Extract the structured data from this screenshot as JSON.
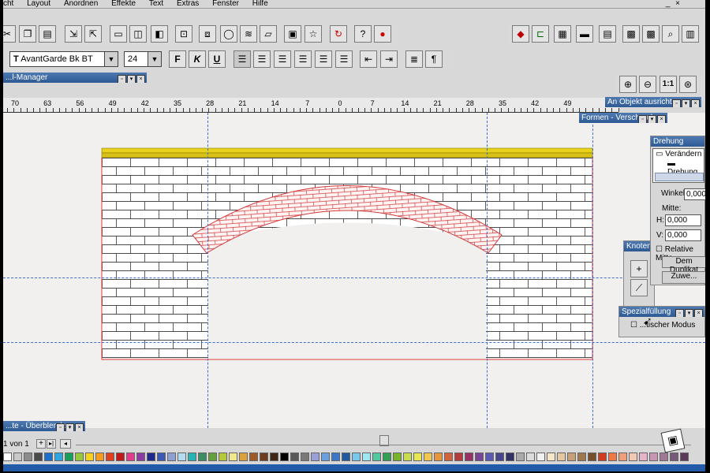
{
  "menu": {
    "items": [
      "cht",
      "Layout",
      "Anordnen",
      "Effekte",
      "Text",
      "Extras",
      "Fenster",
      "Hilfe"
    ]
  },
  "format_toolbar": {
    "font_name": "AvantGarde Bk BT",
    "font_size": "24",
    "bold_label": "F",
    "italic_label": "K",
    "underline_label": "U",
    "para_label": "¶"
  },
  "panels": {
    "manager_title": "...l-Manager",
    "align_title": "An Objekt ausrichten",
    "shapes_title": "Formen - Verschmel...",
    "rotation": {
      "title": "Drehung",
      "tree_root": "Verändern",
      "tree_child": "Drehung",
      "angle_label": "Winkel:",
      "angle_value": "0,000",
      "center_label": "Mitte:",
      "h_label": "H:",
      "h_value": "0,000",
      "v_label": "V:",
      "v_value": "0,000",
      "relative_label": "Relative Mitte",
      "duplicate_button": "Dem Duplikat",
      "apply_button": "Zuwe..."
    },
    "nodes_title": "Knoten...",
    "special_title": "Spezialfüllung",
    "special_mode": "...tischer Modus",
    "blend_title": "...te - Überblender"
  },
  "zoom": {
    "one_to_one": "1:1"
  },
  "ruler": {
    "labels": [
      "70",
      "63",
      "56",
      "49",
      "42",
      "35",
      "28",
      "21",
      "14",
      "7",
      "0",
      "7",
      "14",
      "21",
      "28",
      "35",
      "42",
      "49"
    ]
  },
  "page_nav": {
    "text": "1 von 1"
  },
  "palette": {
    "colors": [
      "#ffffff",
      "#c8c8c8",
      "#8c8c8c",
      "#4a4a4a",
      "#1d70c9",
      "#2ea7e0",
      "#17a05a",
      "#96c83c",
      "#f5d21e",
      "#f39c1e",
      "#e0401e",
      "#c21a1a",
      "#e23c8c",
      "#8c3ca0",
      "#1e2a8c",
      "#3c5ab4",
      "#8ca0d2",
      "#b4dcf0",
      "#28b4b4",
      "#3c8c64",
      "#64a03c",
      "#b4c83c",
      "#f0e68c",
      "#dca03c",
      "#a05a28",
      "#6e3c1e",
      "#3c2814",
      "#000000",
      "#5a5a5a",
      "#7a7a7a",
      "#9aa0d8",
      "#6aa0e0",
      "#3c78c8",
      "#1e5aa0",
      "#78c8f0",
      "#a0e6f0",
      "#50c8a0",
      "#32a050",
      "#78b428",
      "#c8dc50",
      "#e6e650",
      "#f0c850",
      "#e6963c",
      "#d2643c",
      "#b43c3c",
      "#963264",
      "#784696",
      "#5a5ab4",
      "#46468c",
      "#323264",
      "#aaaaaa",
      "#dcdcdc",
      "#f0f0f0",
      "#f5e6c8",
      "#e6c8a0",
      "#c8a078",
      "#a07850",
      "#784f2c",
      "#d23c1e",
      "#f07846",
      "#f0a078",
      "#f0c8b4",
      "#e6b4c8",
      "#c896b4",
      "#a07896",
      "#785a78",
      "#5a3c5a"
    ]
  }
}
